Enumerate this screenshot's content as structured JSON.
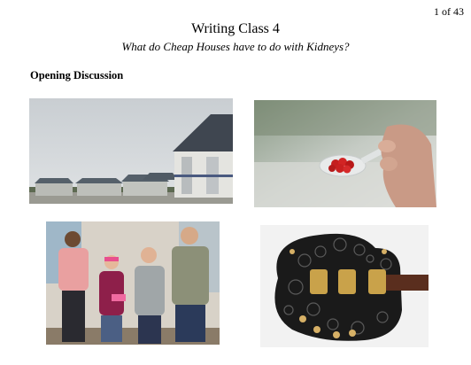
{
  "page": {
    "counter": "1 of 43",
    "title": "Writing Class 4",
    "subtitle": "What do Cheap Houses have to do with Kidneys?",
    "section_heading": "Opening Discussion"
  },
  "images": {
    "houses": "houses-photo",
    "spoon": "gel-spoon-photo",
    "people": "group-photo",
    "guitar": "printed-guitar-photo"
  }
}
